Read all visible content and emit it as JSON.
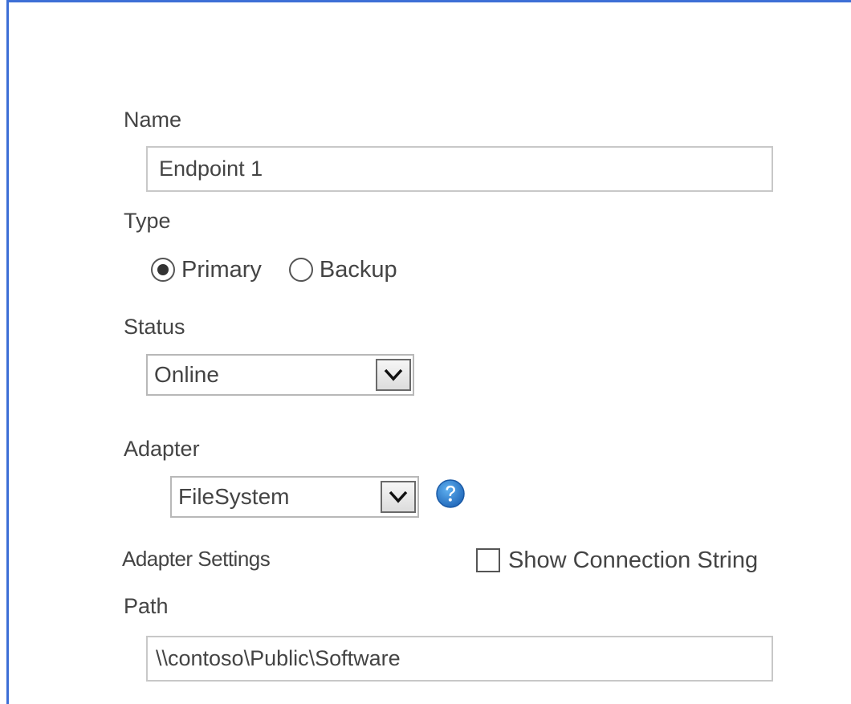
{
  "form": {
    "name": {
      "label": "Name",
      "value": "Endpoint 1"
    },
    "type": {
      "label": "Type",
      "options": [
        {
          "label": "Primary",
          "selected": true
        },
        {
          "label": "Backup",
          "selected": false
        }
      ]
    },
    "status": {
      "label": "Status",
      "selected": "Online"
    },
    "adapter": {
      "label": "Adapter",
      "selected": "FileSystem",
      "help_icon": "help-question-icon"
    },
    "adapter_settings": {
      "label": "Adapter Settings",
      "show_connection_string_label": "Show Connection String",
      "show_connection_string_checked": false
    },
    "path": {
      "label": "Path",
      "value": "\\\\contoso\\Public\\Software"
    }
  },
  "colors": {
    "accent_border": "#3d6fd6",
    "help_icon": "#2a7fd4",
    "text": "#444444"
  }
}
